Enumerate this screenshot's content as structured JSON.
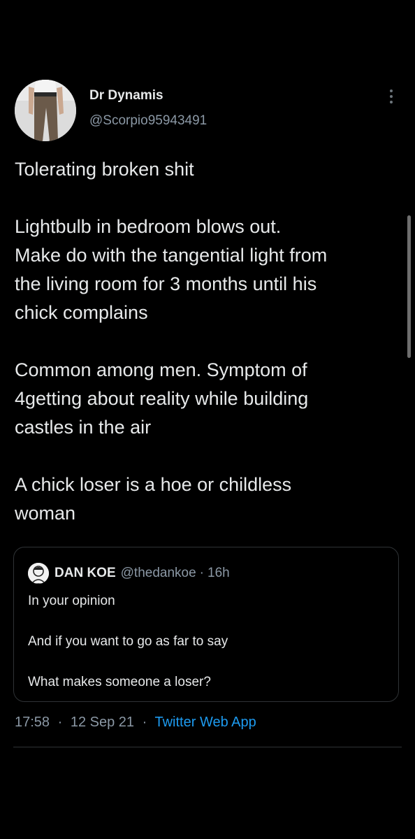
{
  "author": {
    "display_name": "Dr Dynamis",
    "handle": "@Scorpio95943491",
    "avatar_icon": "profile-photo"
  },
  "more_icon": "more-vertical-icon",
  "tweet": {
    "paragraphs": [
      [
        "Tolerating broken shit"
      ],
      [
        "Lightbulb in bedroom blows out.",
        "Make do with the tangential light from",
        "the living room for 3 months until his",
        "chick complains"
      ],
      [
        "Common among men. Symptom of",
        "4getting about reality while building",
        "castles in the air"
      ],
      [
        "A chick loser is a hoe or childless",
        "woman"
      ]
    ]
  },
  "quote": {
    "display_name": "DAN KOE",
    "handle": "@thedankoe",
    "separator": "·",
    "time": "16h",
    "paragraphs": [
      "In your opinion",
      "And if you want to go as far to say",
      "What makes someone a loser?"
    ]
  },
  "meta": {
    "time": "17:58",
    "separator": "·",
    "date": "12 Sep 21",
    "source": "Twitter Web App"
  },
  "colors": {
    "background": "#000000",
    "primary_text": "#e7e9ea",
    "secondary_text": "#8b98a5",
    "link": "#1d9bf0",
    "border": "#2f3336"
  }
}
